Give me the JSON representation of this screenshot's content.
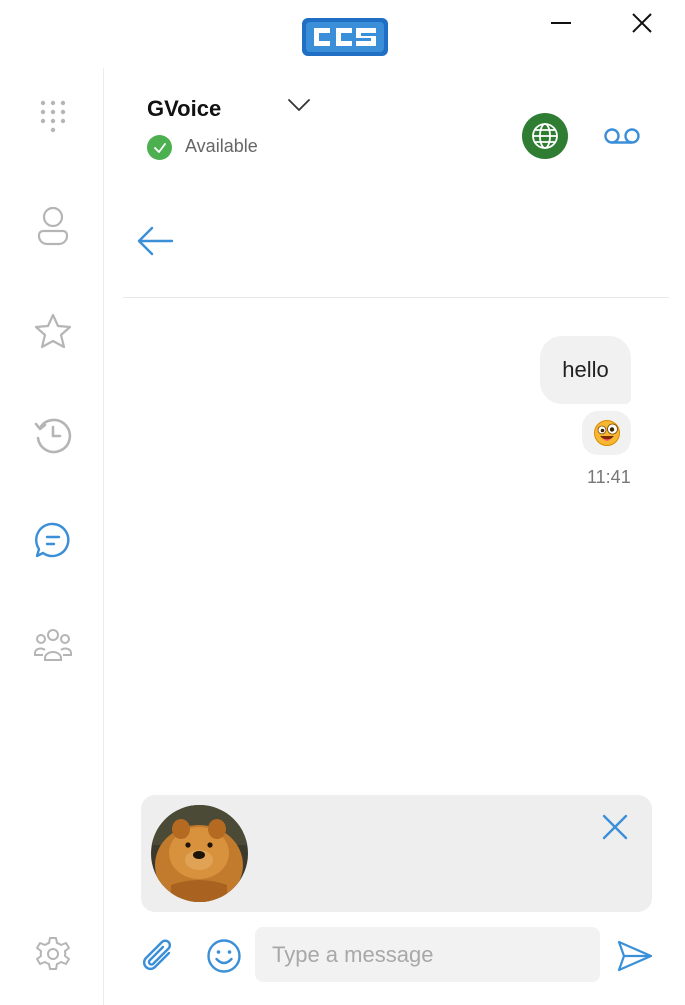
{
  "colors": {
    "accent": "#3a8fd8",
    "icon_gray": "#b5b5b5",
    "status_green": "#4caf50",
    "globe_green": "#2e7d32",
    "bubble_bg": "#f1f1f1"
  },
  "titlebar": {
    "logo_icon": "cc-logo",
    "minimize_icon": "minimize-icon",
    "close_icon": "close-icon"
  },
  "sidebar": {
    "items": [
      {
        "icon": "dialpad-icon",
        "active": false
      },
      {
        "icon": "contact-icon",
        "active": false
      },
      {
        "icon": "star-icon",
        "active": false
      },
      {
        "icon": "history-icon",
        "active": false
      },
      {
        "icon": "chat-icon",
        "active": true
      },
      {
        "icon": "group-icon",
        "active": false
      }
    ],
    "settings_icon": "gear-icon"
  },
  "header": {
    "account_name": "GVoice",
    "status": "Available"
  },
  "conversation": {
    "messages": [
      {
        "type": "text",
        "text": "hello"
      },
      {
        "type": "emoji",
        "emoji": "crazy-face-emoji"
      }
    ],
    "time": "11:41"
  },
  "attachment": {
    "thumb": "dog-photo"
  },
  "composer": {
    "placeholder": "Type a message",
    "value": ""
  }
}
